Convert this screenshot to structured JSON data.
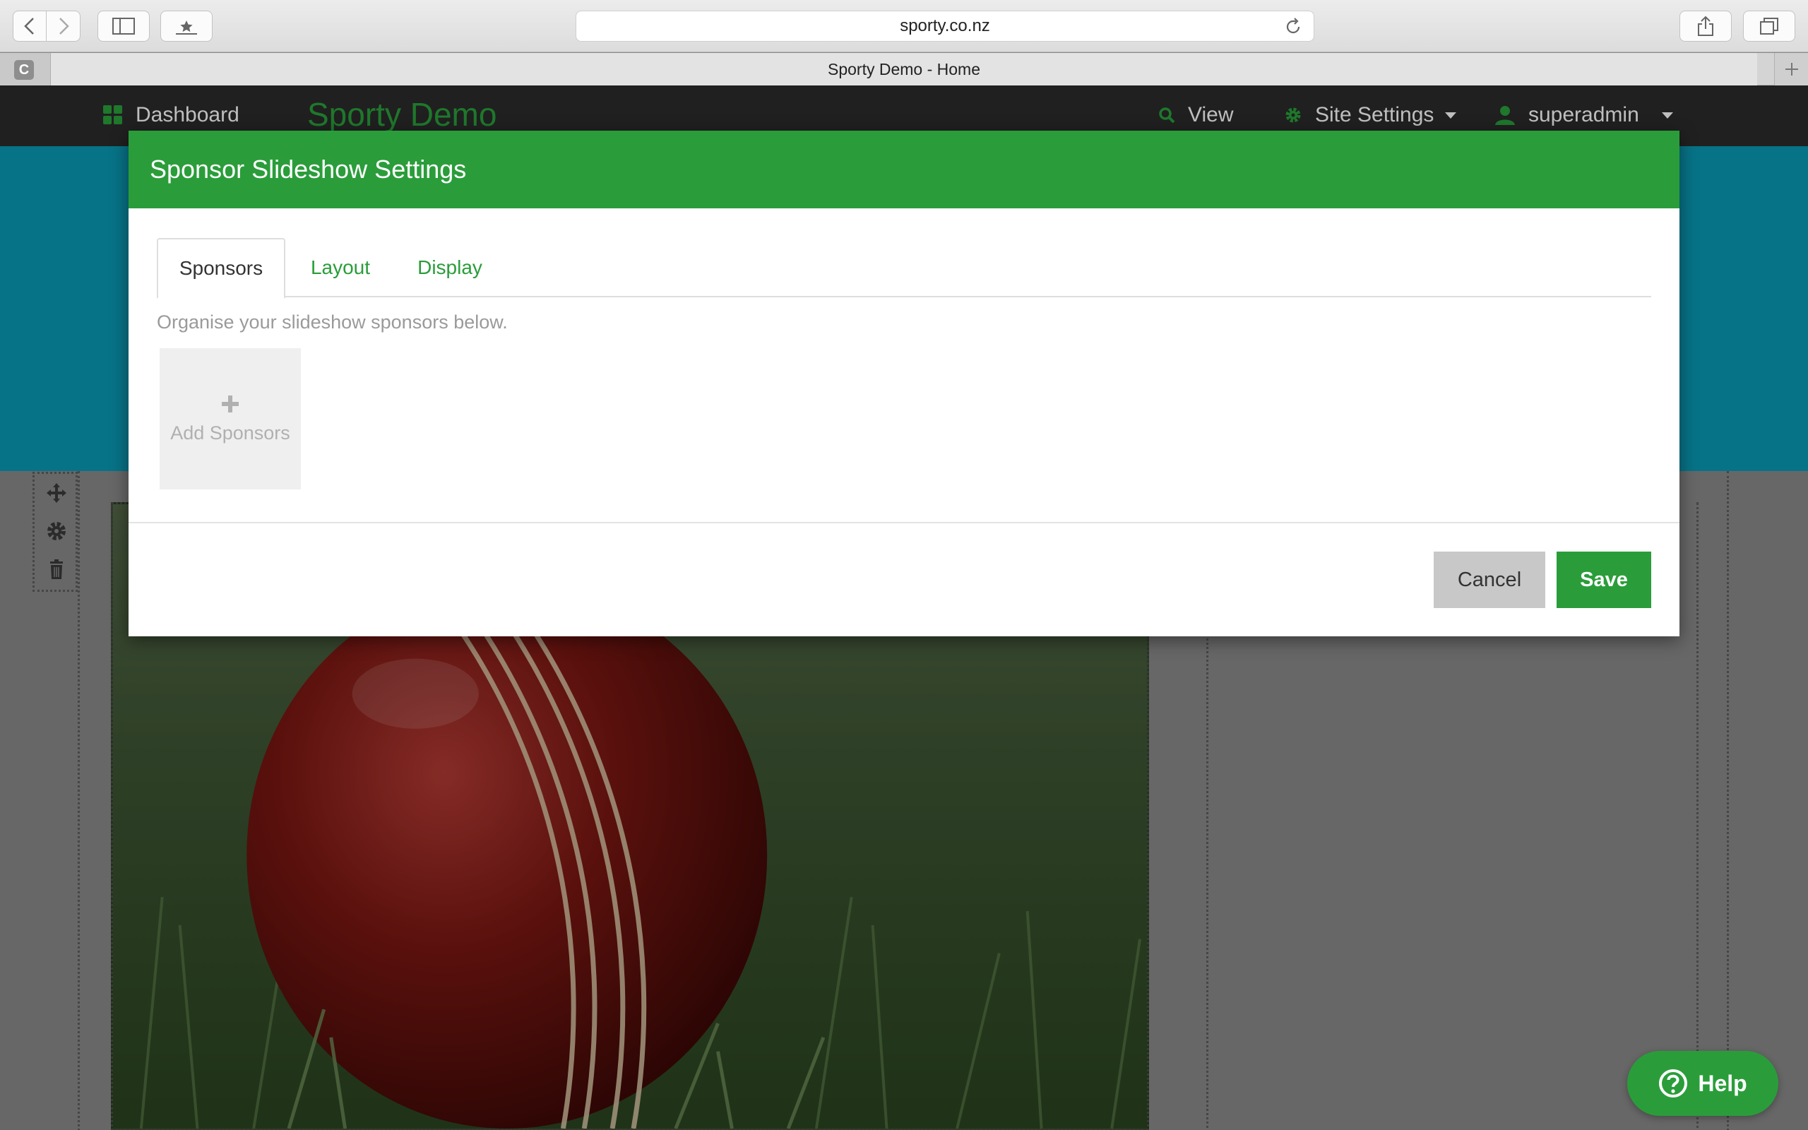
{
  "browser": {
    "url": "sporty.co.nz",
    "tab_title": "Sporty Demo - Home",
    "favicon_letter": "C"
  },
  "topnav": {
    "dashboard": "Dashboard",
    "brand": "Sporty Demo",
    "view": "View",
    "site_settings": "Site Settings",
    "user": "superadmin"
  },
  "modal": {
    "title": "Sponsor Slideshow Settings",
    "tabs": [
      {
        "label": "Sponsors",
        "active": true
      },
      {
        "label": "Layout",
        "active": false
      },
      {
        "label": "Display",
        "active": false
      }
    ],
    "help_text": "Organise your slideshow sponsors below.",
    "add_sponsors": "Add Sponsors",
    "cancel": "Cancel",
    "save": "Save"
  },
  "help": {
    "label": "Help"
  },
  "colors": {
    "accent": "#2a9d3a",
    "nav_bg": "#2b2b2b",
    "hero": "#0a9ab4"
  },
  "icons": {
    "back": "chevron-left-icon",
    "forward": "chevron-right-icon",
    "sidebar": "sidebar-icon",
    "bookmarks": "star-icon",
    "reload": "reload-icon",
    "share": "share-icon",
    "tabs": "tabs-icon",
    "dashboard": "grid-icon",
    "view": "search-icon",
    "settings": "gear-icon",
    "user": "user-icon",
    "move": "move-icon",
    "widget_settings": "gear-icon",
    "delete": "trash-icon",
    "add": "plus-icon",
    "help": "question-icon"
  }
}
